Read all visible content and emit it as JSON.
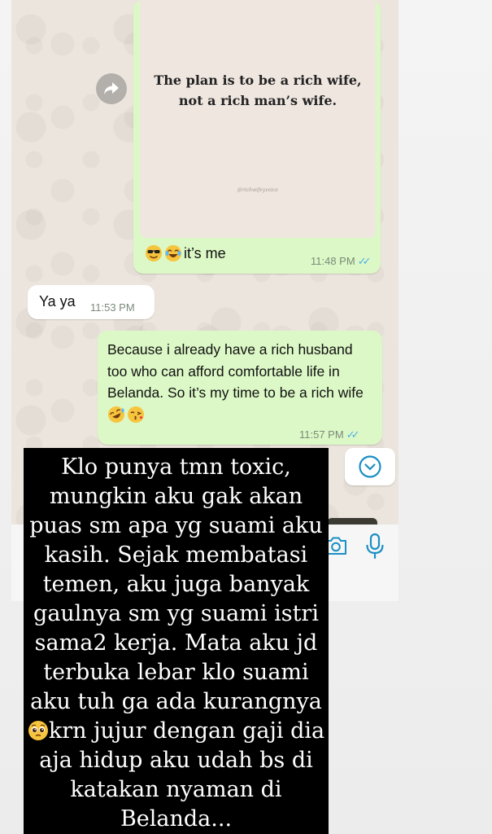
{
  "messages": {
    "image_quote": {
      "quote": "The plan is to be a rich wife, not a rich man’s wife.",
      "signature": "@richwifeyvoice",
      "caption": "it’s me",
      "caption_emojis": [
        "sunglasses-emoji",
        "joy-emoji"
      ],
      "time": "11:48 PM",
      "status": "read"
    },
    "incoming": {
      "text": "Ya ya",
      "time": "11:53 PM"
    },
    "outgoing": {
      "text": "Because i already have a rich husband too who can afford comfortable life in Belanda. So it’s my time to be a rich wife",
      "emojis": [
        "rofl-emoji",
        "kiss-emoji"
      ],
      "time": "11:57 PM",
      "status": "read"
    }
  },
  "overlay": {
    "text": "Klo punya tmn toxic, mungkin aku gak akan puas sm apa yg suami aku kasih. Sejak membatasi temen, aku juga banyak gaulnya sm yg suami istri sama2 kerja. Mata aku jd terbuka lebar klo suami aku tuh ga ada kurangnya",
    "emoji": "pleading-face-emoji",
    "text_after": "krn jujur dengan gaji dia aja hidup aku udah bs di katakan nyaman di Belanda..."
  },
  "colors": {
    "outgoing_bubble": "#dcf8c6",
    "incoming_bubble": "#ffffff",
    "chat_background": "#ece5dd",
    "read_ticks": "#4fb0e8",
    "accent": "#1a8fc4"
  },
  "icons": {
    "forward": "forward-icon",
    "scroll_down": "chevron-down-circle-icon",
    "camera": "camera-icon",
    "mic": "mic-icon"
  }
}
